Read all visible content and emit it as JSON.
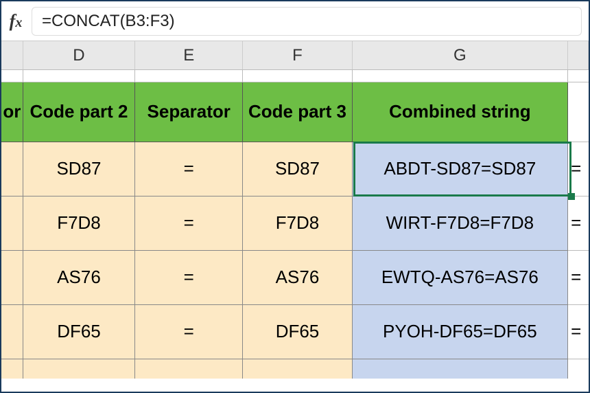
{
  "formula": "=CONCAT(B3:F3)",
  "columns": {
    "d": "D",
    "e": "E",
    "f": "F",
    "g": "G"
  },
  "headers": {
    "c_partial": "or",
    "d": "Code part 2",
    "e": "Separator",
    "f": "Code part 3",
    "g": "Combined string"
  },
  "rows": [
    {
      "d": "SD87",
      "e": "=",
      "f": "SD87",
      "g": "ABDT-SD87=SD87",
      "h": "="
    },
    {
      "d": "F7D8",
      "e": "=",
      "f": "F7D8",
      "g": "WIRT-F7D8=F7D8",
      "h": "="
    },
    {
      "d": "AS76",
      "e": "=",
      "f": "AS76",
      "g": "EWTQ-AS76=AS76",
      "h": "="
    },
    {
      "d": "DF65",
      "e": "=",
      "f": "DF65",
      "g": "PYOH-DF65=DF65",
      "h": "="
    }
  ]
}
